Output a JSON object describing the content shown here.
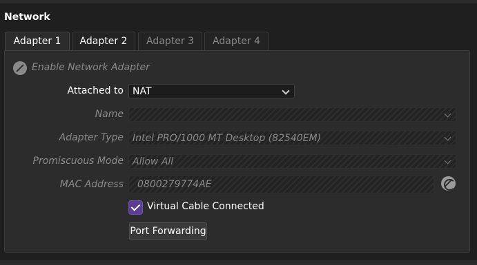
{
  "section": {
    "title": "Network"
  },
  "tabs": [
    {
      "label": "Adapter 1",
      "state": "active"
    },
    {
      "label": "Adapter 2",
      "state": "enabled"
    },
    {
      "label": "Adapter 3",
      "state": "disabled"
    },
    {
      "label": "Adapter 4",
      "state": "disabled"
    }
  ],
  "adapter": {
    "enable_label": "Enable Network Adapter",
    "enable_checked": true,
    "attached_to": {
      "label": "Attached to",
      "value": "NAT"
    },
    "name": {
      "label": "Name",
      "value": ""
    },
    "adapter_type": {
      "label": "Adapter Type",
      "value": "Intel PRO/1000 MT Desktop (82540EM)"
    },
    "promiscuous_mode": {
      "label": "Promiscuous Mode",
      "value": "Allow All"
    },
    "mac_address": {
      "label": "MAC Address",
      "value": "0800279774AE"
    },
    "virtual_cable": {
      "label": "Virtual Cable Connected",
      "checked": true
    },
    "port_forwarding_label": "Port Forwarding"
  },
  "colors": {
    "accent_checkbox": "#5a3f92",
    "background": "#1f1f1f",
    "panel": "#2c2c2c",
    "disabled_text": "#8a8a8a"
  },
  "icons": {
    "enable_checkbox": "disabled-check-icon",
    "mac_refresh": "refresh-icon",
    "dropdown": "chevron-down-icon",
    "checkbox": "check-icon"
  }
}
